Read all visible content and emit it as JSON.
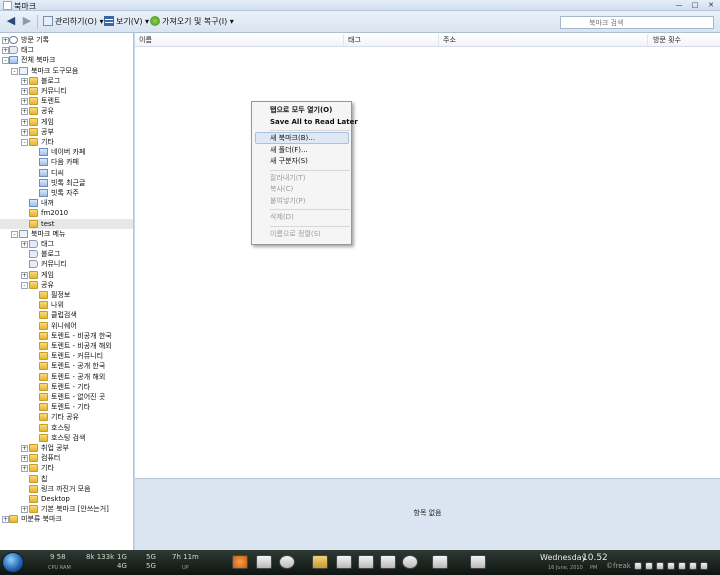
{
  "window": {
    "title": "북마크"
  },
  "toolbar": {
    "back_icon": "back-arrow-icon",
    "forward_icon": "forward-arrow-icon",
    "organize": "관리하기(O)",
    "views": "보기(V)",
    "import_backup": "가져오기 및 복구(I)",
    "search_placeholder": "북마크 검색"
  },
  "tree": [
    {
      "label": "방문 기록",
      "level": 0,
      "exp": "+",
      "icon": "clock"
    },
    {
      "label": "태그",
      "level": 0,
      "exp": "+",
      "icon": "tag"
    },
    {
      "label": "전체 북마크",
      "level": 0,
      "exp": "-",
      "icon": "bm"
    },
    {
      "label": "북마크 도구모음",
      "level": 1,
      "exp": "-",
      "icon": "bar"
    },
    {
      "label": "블로그",
      "level": 2,
      "exp": "+",
      "icon": "folder"
    },
    {
      "label": "커뮤니티",
      "level": 2,
      "exp": "+",
      "icon": "folder"
    },
    {
      "label": "토렌트",
      "level": 2,
      "exp": "+",
      "icon": "folder"
    },
    {
      "label": "공유",
      "level": 2,
      "exp": "+",
      "icon": "folder"
    },
    {
      "label": "게임",
      "level": 2,
      "exp": "+",
      "icon": "folder"
    },
    {
      "label": "공부",
      "level": 2,
      "exp": "+",
      "icon": "folder"
    },
    {
      "label": "기타",
      "level": 2,
      "exp": "-",
      "icon": "folder"
    },
    {
      "label": "네이버 카페",
      "level": 3,
      "exp": "",
      "icon": "bm"
    },
    {
      "label": "다음 카페",
      "level": 3,
      "exp": "",
      "icon": "bm"
    },
    {
      "label": "디씨",
      "level": 3,
      "exp": "",
      "icon": "bm"
    },
    {
      "label": "빗톡 최근글",
      "level": 3,
      "exp": "",
      "icon": "bm"
    },
    {
      "label": "빗톡 자주",
      "level": 3,
      "exp": "",
      "icon": "bm"
    },
    {
      "label": "내꺼",
      "level": 2,
      "exp": "",
      "icon": "bm"
    },
    {
      "label": "fm2010",
      "level": 2,
      "exp": "",
      "icon": "folder"
    },
    {
      "label": "test",
      "level": 2,
      "exp": "",
      "icon": "folder",
      "selected": true
    },
    {
      "label": "북마크 메뉴",
      "level": 1,
      "exp": "-",
      "icon": "bar"
    },
    {
      "label": "태그",
      "level": 2,
      "exp": "+",
      "icon": "tag"
    },
    {
      "label": "블로그",
      "level": 2,
      "exp": "",
      "icon": "tag"
    },
    {
      "label": "커뮤니티",
      "level": 2,
      "exp": "",
      "icon": "tag"
    },
    {
      "label": "게임",
      "level": 2,
      "exp": "+",
      "icon": "folder"
    },
    {
      "label": "공유",
      "level": 2,
      "exp": "-",
      "icon": "folder"
    },
    {
      "label": "필정보",
      "level": 3,
      "exp": "",
      "icon": "folder"
    },
    {
      "label": "나위",
      "level": 3,
      "exp": "",
      "icon": "folder"
    },
    {
      "label": "클럽검색",
      "level": 3,
      "exp": "",
      "icon": "folder"
    },
    {
      "label": "위니쉐어",
      "level": 3,
      "exp": "",
      "icon": "folder"
    },
    {
      "label": "토렌트 - 비공개 한국",
      "level": 3,
      "exp": "",
      "icon": "folder"
    },
    {
      "label": "토렌트 - 비공개 해외",
      "level": 3,
      "exp": "",
      "icon": "folder"
    },
    {
      "label": "토렌트 - 커뮤니티",
      "level": 3,
      "exp": "",
      "icon": "folder"
    },
    {
      "label": "토렌트 - 공개 한국",
      "level": 3,
      "exp": "",
      "icon": "folder"
    },
    {
      "label": "토렌트 - 공개 해외",
      "level": 3,
      "exp": "",
      "icon": "folder"
    },
    {
      "label": "토렌트 - 기타",
      "level": 3,
      "exp": "",
      "icon": "folder"
    },
    {
      "label": "토렌트 - 없어진 곳",
      "level": 3,
      "exp": "",
      "icon": "folder"
    },
    {
      "label": "토렌트 - 기타",
      "level": 3,
      "exp": "",
      "icon": "folder"
    },
    {
      "label": "기타 공유",
      "level": 3,
      "exp": "",
      "icon": "folder"
    },
    {
      "label": "호스팅",
      "level": 3,
      "exp": "",
      "icon": "folder"
    },
    {
      "label": "호스팅 검색",
      "level": 3,
      "exp": "",
      "icon": "folder"
    },
    {
      "label": "취업 공부",
      "level": 2,
      "exp": "+",
      "icon": "folder"
    },
    {
      "label": "컴퓨터",
      "level": 2,
      "exp": "+",
      "icon": "folder"
    },
    {
      "label": "기타",
      "level": 2,
      "exp": "+",
      "icon": "folder"
    },
    {
      "label": "칩",
      "level": 2,
      "exp": "",
      "icon": "folder"
    },
    {
      "label": "링크 까진거 모음",
      "level": 2,
      "exp": "",
      "icon": "folder"
    },
    {
      "label": "Desktop",
      "level": 2,
      "exp": "",
      "icon": "folder"
    },
    {
      "label": "기본 북마크 [안쓰는거]",
      "level": 2,
      "exp": "+",
      "icon": "folder"
    },
    {
      "label": "미분류 북마크",
      "level": 0,
      "exp": "+",
      "icon": "folder"
    }
  ],
  "columns": [
    "이름",
    "태그",
    "주소",
    "방문 횟수"
  ],
  "detail": {
    "empty_text": "항목 없음"
  },
  "context_menu": {
    "items": [
      {
        "label": "탭으로 모두 열기(O)",
        "bold": true,
        "disabled": false
      },
      {
        "label": "Save All to Read Later",
        "bold": true,
        "disabled": false
      },
      {
        "sep": true
      },
      {
        "label": "새 북마크(B)...",
        "bold": false,
        "disabled": false,
        "highlight": true
      },
      {
        "label": "새 폴더(F)...",
        "bold": false,
        "disabled": false
      },
      {
        "label": "새 구분자(S)",
        "bold": false,
        "disabled": false
      },
      {
        "sep": true
      },
      {
        "label": "잘라내기(T)",
        "bold": false,
        "disabled": true
      },
      {
        "label": "복사(C)",
        "bold": false,
        "disabled": true
      },
      {
        "label": "붙여넣기(P)",
        "bold": false,
        "disabled": true
      },
      {
        "sep": true
      },
      {
        "label": "삭제(D)",
        "bold": false,
        "disabled": true
      },
      {
        "sep": true
      },
      {
        "label": "이름으로 정렬(S)",
        "bold": false,
        "disabled": true
      }
    ]
  },
  "taskbar": {
    "cpu_value": "9 58",
    "cpu_label": "CPU RAM",
    "net1": "8k 133k",
    "net2": "1G 4G",
    "net3": "5G 5G",
    "uptime": "7h 11m",
    "uptime_label": "UP",
    "day": "Wednesday",
    "date": "16 June, 2010",
    "time": "10.52",
    "ampm": "PM",
    "brand": "©freak"
  }
}
